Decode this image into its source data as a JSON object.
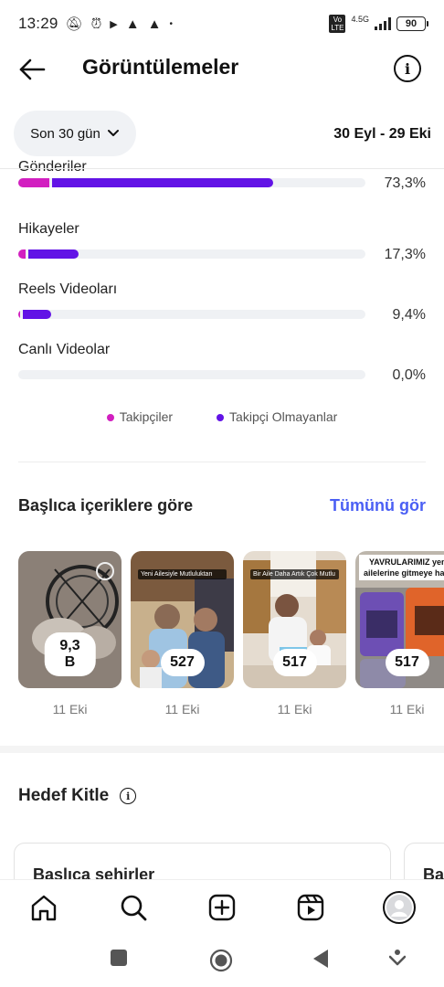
{
  "status_bar": {
    "time": "13:29",
    "network": "4.5G",
    "battery": "90"
  },
  "header": {
    "title": "Görüntülemeler"
  },
  "filter": {
    "period_label": "Son 30 gün",
    "date_range": "30 Eyl - 29 Eki"
  },
  "breakdown": {
    "rows": [
      {
        "label": "Gönderiler",
        "percent_text": "73,3%",
        "followers_pct": 9,
        "non_followers_pct": 64.3
      },
      {
        "label": "Hikayeler",
        "percent_text": "17,3%",
        "followers_pct": 2,
        "non_followers_pct": 15.3
      },
      {
        "label": "Reels Videoları",
        "percent_text": "9,4%",
        "followers_pct": 0.5,
        "non_followers_pct": 8.9
      },
      {
        "label": "Canlı Videolar",
        "percent_text": "0,0%",
        "followers_pct": 0,
        "non_followers_pct": 0
      }
    ],
    "legend": {
      "followers": "Takipçiler",
      "non_followers": "Takipçi Olmayanlar"
    },
    "colors": {
      "followers": "#d21fc0",
      "non_followers": "#6213e6",
      "track": "#eff1f4"
    }
  },
  "top_content": {
    "title": "Başlıca içeriklere göre",
    "see_all": "Tümünü gör",
    "items": [
      {
        "count": "9,3 B",
        "date": "11 Eki",
        "caption": ""
      },
      {
        "count": "527",
        "date": "11 Eki",
        "caption": "Yeni Ailesiyle Mutluluktan"
      },
      {
        "count": "517",
        "date": "11 Eki",
        "caption": "Bir Aile Daha Artık Çok Mutlu"
      },
      {
        "count": "517",
        "date": "11 Eki",
        "caption": "YAVRULARIMIZ yeni ailelerine gitmeye hazır"
      }
    ]
  },
  "audience": {
    "title": "Hedef Kitle",
    "card_title": "Başlıca şehirler",
    "card2_title": "Ba"
  }
}
